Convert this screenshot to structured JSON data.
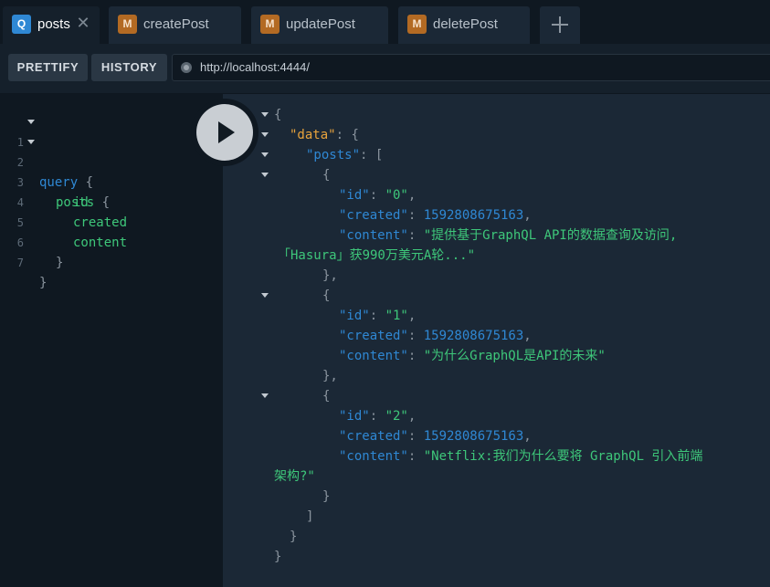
{
  "tabs": [
    {
      "badge": "Q",
      "label": "posts",
      "close": "✕"
    },
    {
      "badge": "M",
      "label": "createPost"
    },
    {
      "badge": "M",
      "label": "updatePost"
    },
    {
      "badge": "M",
      "label": "deletePost"
    }
  ],
  "toolbar": {
    "prettify_label": "PRETTIFY",
    "history_label": "HISTORY",
    "endpoint_url": "http://localhost:4444/"
  },
  "query_editor": {
    "line_numbers": [
      "1",
      "2",
      "3",
      "4",
      "5",
      "6",
      "7"
    ],
    "tokens": {
      "query_kw": "query",
      "open_brace": "{",
      "posts_field": "posts",
      "id_field": "id",
      "created_field": "created",
      "content_field": "content",
      "close_brace": "}"
    }
  },
  "result": {
    "open": "{",
    "close": "}",
    "data_key": "\"data\"",
    "posts_key": "\"posts\"",
    "array_open": "[",
    "array_close": "]",
    "obj_open": "{",
    "obj_close_comma": "},",
    "obj_close": "}",
    "colon": ": ",
    "comma": ",",
    "id_key": "\"id\"",
    "created_key": "\"created\"",
    "content_key": "\"content\"",
    "posts": [
      {
        "id": "\"0\"",
        "created": "1592808675163",
        "content_line1": "\"提供基于GraphQL API的数据查询及访问,",
        "content_line2": "「Hasura」获990万美元A轮...\""
      },
      {
        "id": "\"1\"",
        "created": "1592808675163",
        "content_line1": "\"为什么GraphQL是API的未来\""
      },
      {
        "id": "\"2\"",
        "created": "1592808675163",
        "content_line1": "\"Netflix:我们为什么要将 GraphQL 引入前端",
        "content_line2": "架构?\""
      }
    ]
  },
  "colors": {
    "accent_blue": "#2f88d4",
    "string_green": "#3ec77a",
    "data_key_orange": "#e8a33c",
    "mutation_badge": "#b36a23"
  }
}
